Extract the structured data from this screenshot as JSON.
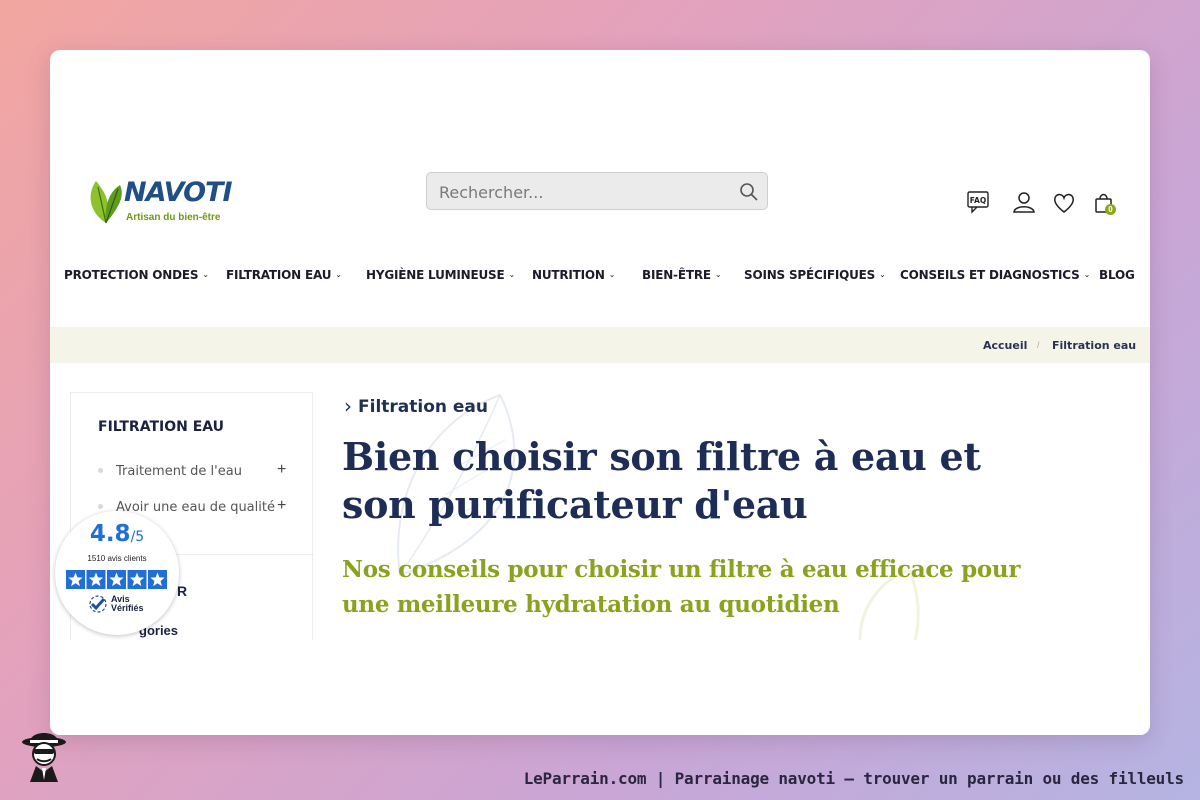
{
  "brand": {
    "name": "NAVOTI",
    "tagline": "Artisan du bien-être"
  },
  "search": {
    "placeholder": "Rechercher..."
  },
  "header_icons": {
    "faq_label": "FAQ",
    "cart_count": "0"
  },
  "nav": {
    "items": [
      {
        "label": "PROTECTION ONDES",
        "dropdown": true
      },
      {
        "label": "FILTRATION EAU",
        "dropdown": true
      },
      {
        "label": "HYGIÈNE LUMINEUSE",
        "dropdown": true
      },
      {
        "label": "NUTRITION",
        "dropdown": true
      },
      {
        "label": "BIEN-ÊTRE",
        "dropdown": true
      },
      {
        "label": "SOINS SPÉCIFIQUES",
        "dropdown": true
      },
      {
        "label": "CONSEILS ET DIAGNOSTICS",
        "dropdown": true
      },
      {
        "label": "BLOG",
        "dropdown": false
      }
    ],
    "chevron": "⌄"
  },
  "breadcrumb": {
    "items": [
      "Accueil",
      "Filtration eau"
    ],
    "separator": "/"
  },
  "sidebar": {
    "title": "FILTRATION EAU",
    "items": [
      {
        "label": "Traitement de l'eau",
        "expand": "+"
      },
      {
        "label": "Avoir une eau de qualité",
        "expand": "+"
      }
    ],
    "partial_1": "R",
    "partial_2": "gories"
  },
  "reviews_badge": {
    "score": "4.8",
    "scale": "/5",
    "count": "1510 avis clients",
    "stars": 5,
    "brand_line1": "Avis",
    "brand_line2": "Vérifiés"
  },
  "main": {
    "kicker": "Filtration eau",
    "kicker_arrow": "›",
    "title": "Bien choisir son filtre à eau et son purificateur d'eau",
    "subtitle": "Nos conseils pour choisir un filtre à eau efficace pour une meilleure hydratation au quotidien"
  },
  "footer": {
    "text": "LeParrain.com | Parrainage navoti — trouver un parrain ou des filleuls"
  },
  "colors": {
    "brand_blue": "#1f4f86",
    "accent_green": "#8aa21d",
    "heading_navy": "#1d2d55",
    "band_bg": "#f4f4e9",
    "reviews_blue": "#1f6fd6"
  }
}
